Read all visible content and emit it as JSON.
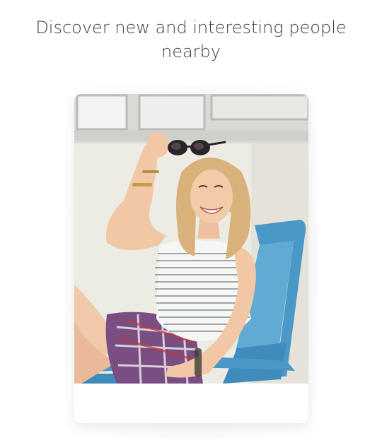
{
  "header": {
    "headline": "Discover new and interesting people nearby"
  },
  "profile_card": {
    "photo_alt": "Smiling woman with sunglasses sitting in a blue chair"
  },
  "colors": {
    "background": "#ffffff",
    "headline_text": "#3a3a3a",
    "chair_blue": "#4a98c8",
    "wall": "#ecebe4"
  },
  "icons": {
    "photo": "profile-photo"
  }
}
